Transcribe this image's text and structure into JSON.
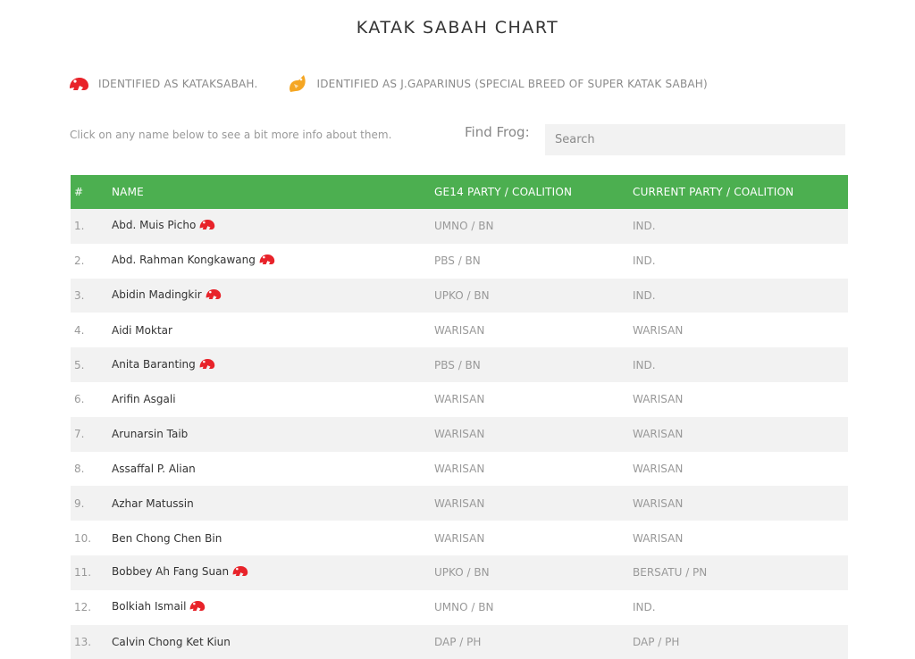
{
  "title": "KATAK SABAH CHART",
  "legend": {
    "katak_icon": "frog-red-icon",
    "katak_color": "#e8232a",
    "katak_label": "IDENTIFIED AS KATAKSABAH.",
    "gaparinus_icon": "frog-orange-icon",
    "gaparinus_color": "#f5a623",
    "gaparinus_label": "IDENTIFIED AS J.GAPARINUS (SPECIAL BREED OF SUPER KATAK SABAH)"
  },
  "hint": "Click on any name below to see a bit more info about them.",
  "search": {
    "label": "Find Frog:",
    "placeholder": "Search"
  },
  "table": {
    "header_color": "#4caf50",
    "headers": [
      "#",
      "NAME",
      "GE14 PARTY / COALITION",
      "CURRENT PARTY / COALITION"
    ],
    "rows": [
      {
        "num": "1.",
        "name": "Abd. Muis Picho",
        "katak": true,
        "ge14": "UMNO / BN",
        "current": "IND."
      },
      {
        "num": "2.",
        "name": "Abd. Rahman Kongkawang",
        "katak": true,
        "ge14": "PBS / BN",
        "current": "IND."
      },
      {
        "num": "3.",
        "name": "Abidin Madingkir",
        "katak": true,
        "ge14": "UPKO / BN",
        "current": "IND."
      },
      {
        "num": "4.",
        "name": "Aidi Moktar",
        "katak": false,
        "ge14": "WARISAN",
        "current": "WARISAN"
      },
      {
        "num": "5.",
        "name": "Anita Baranting",
        "katak": true,
        "ge14": "PBS / BN",
        "current": "IND."
      },
      {
        "num": "6.",
        "name": "Arifin Asgali",
        "katak": false,
        "ge14": "WARISAN",
        "current": "WARISAN"
      },
      {
        "num": "7.",
        "name": "Arunarsin Taib",
        "katak": false,
        "ge14": "WARISAN",
        "current": "WARISAN"
      },
      {
        "num": "8.",
        "name": "Assaffal P. Alian",
        "katak": false,
        "ge14": "WARISAN",
        "current": "WARISAN"
      },
      {
        "num": "9.",
        "name": "Azhar Matussin",
        "katak": false,
        "ge14": "WARISAN",
        "current": "WARISAN"
      },
      {
        "num": "10.",
        "name": "Ben Chong Chen Bin",
        "katak": false,
        "ge14": "WARISAN",
        "current": "WARISAN"
      },
      {
        "num": "11.",
        "name": "Bobbey Ah Fang Suan",
        "katak": true,
        "ge14": "UPKO / BN",
        "current": "BERSATU / PN"
      },
      {
        "num": "12.",
        "name": "Bolkiah Ismail",
        "katak": true,
        "ge14": "UMNO / BN",
        "current": "IND."
      },
      {
        "num": "13.",
        "name": "Calvin Chong Ket Kiun",
        "katak": false,
        "ge14": "DAP / PH",
        "current": "DAP / PH"
      }
    ]
  }
}
